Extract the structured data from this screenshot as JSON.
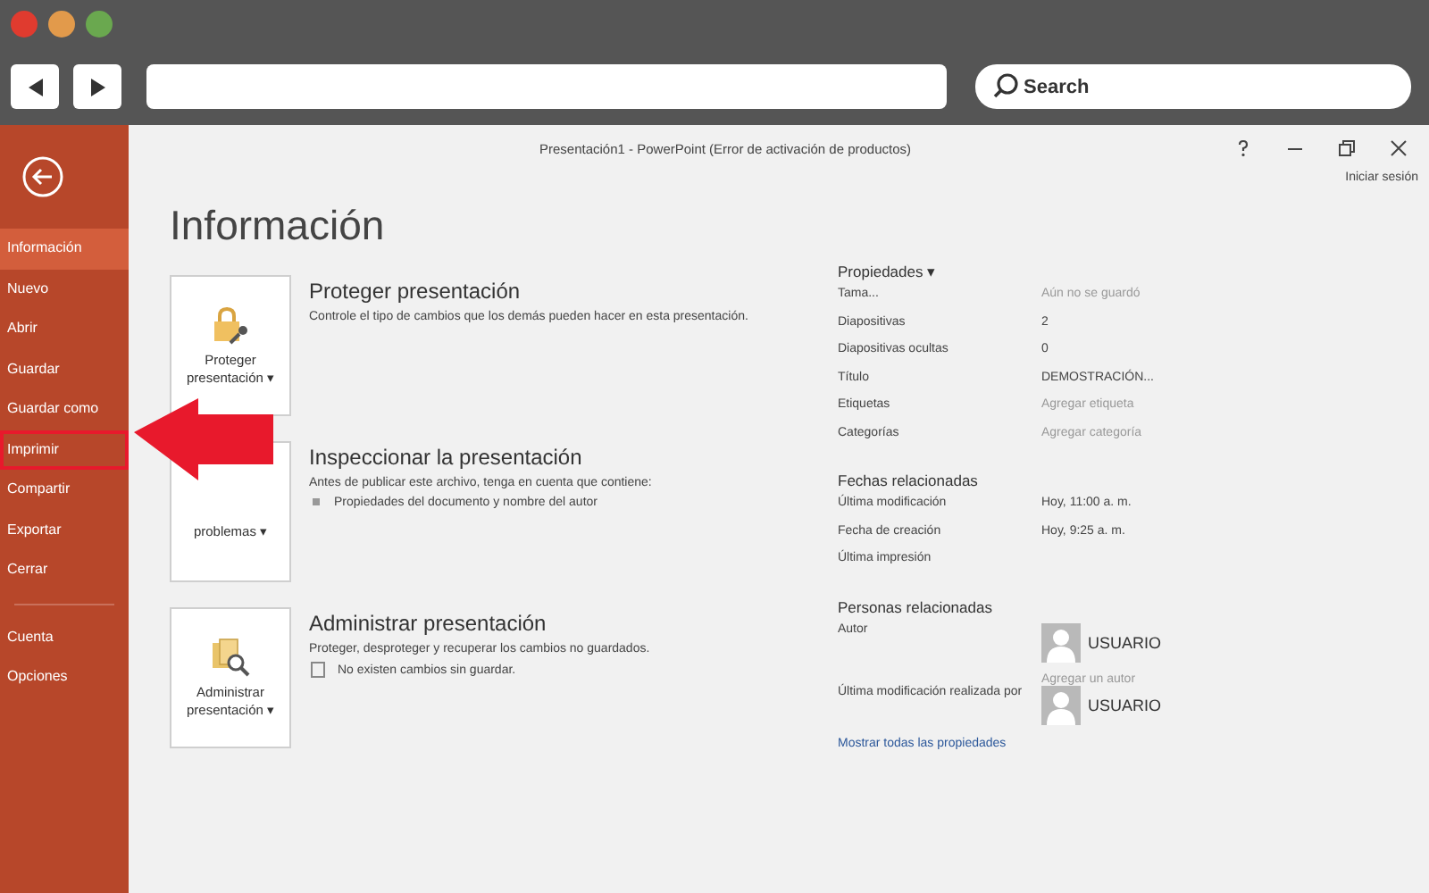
{
  "browser": {
    "search": {
      "placeholder": "Search"
    }
  },
  "window": {
    "title": "Presentación1 - PowerPoint (Error de activación de productos)",
    "sign_in": "Iniciar sesión"
  },
  "sidebar": {
    "items": [
      {
        "label": "Información",
        "selected": true,
        "annotated": false
      },
      {
        "label": "Nuevo",
        "selected": false,
        "annotated": false
      },
      {
        "label": "Abrir",
        "selected": false,
        "annotated": false
      },
      {
        "label": "Guardar",
        "selected": false,
        "annotated": false
      },
      {
        "label": "Guardar como",
        "selected": false,
        "annotated": false
      },
      {
        "label": "Imprimir",
        "selected": false,
        "annotated": true
      },
      {
        "label": "Compartir",
        "selected": false,
        "annotated": false
      },
      {
        "label": "Exportar",
        "selected": false,
        "annotated": false
      },
      {
        "label": "Cerrar",
        "selected": false,
        "annotated": false
      }
    ],
    "footer_items": [
      {
        "label": "Cuenta",
        "selected": false,
        "annotated": false
      },
      {
        "label": "Opciones",
        "selected": false,
        "annotated": false
      }
    ]
  },
  "heading": "Información",
  "sections": [
    {
      "kind": "lock",
      "button": [
        "Proteger",
        "presentación ▾"
      ],
      "title": "Proteger presentación",
      "description": "Controle el tipo de cambios que los demás pueden hacer en esta presentación."
    },
    {
      "kind": "inspect",
      "button": [
        "problemas ▾"
      ],
      "title": "Inspeccionar la presentación",
      "description": "Antes de publicar este archivo, tenga en cuenta que contiene:",
      "bullet": "Propiedades del documento y nombre del autor"
    },
    {
      "kind": "manage",
      "button": [
        "Administrar",
        "presentación ▾"
      ],
      "title": "Administrar presentación",
      "description": "Proteger, desproteger y recuperar los cambios no guardados.",
      "bullet": "No existen cambios sin guardar."
    }
  ],
  "properties": {
    "title": "Propiedades ▾",
    "rows": [
      {
        "label": "Tama...",
        "value": "Aún no se guardó",
        "muted": true
      },
      {
        "label": "Diapositivas",
        "value": "2",
        "muted": false
      },
      {
        "label": "Diapositivas ocultas",
        "value": "0",
        "muted": false
      },
      {
        "label": "Título",
        "value": "DEMOSTRACIÓN...",
        "muted": false
      },
      {
        "label": "Etiquetas",
        "value": "Agregar etiqueta",
        "muted": true
      },
      {
        "label": "Categorías",
        "value": "Agregar categoría",
        "muted": true
      }
    ]
  },
  "dates": {
    "title": "Fechas relacionadas",
    "rows": [
      {
        "label": "Última modificación",
        "value": "Hoy, 11:00 a. m."
      },
      {
        "label": "Fecha de creación",
        "value": "Hoy, 9:25 a. m."
      },
      {
        "label": "Última impresión"
      }
    ]
  },
  "people": {
    "title": "Personas relacionadas",
    "author_label": "Autor",
    "author": "USUARIO",
    "add_author": "Agregar un autor",
    "modified_label": "Última modificación realizada por",
    "modified_by": "USUARIO"
  },
  "show_all": "Mostrar todas las propiedades"
}
